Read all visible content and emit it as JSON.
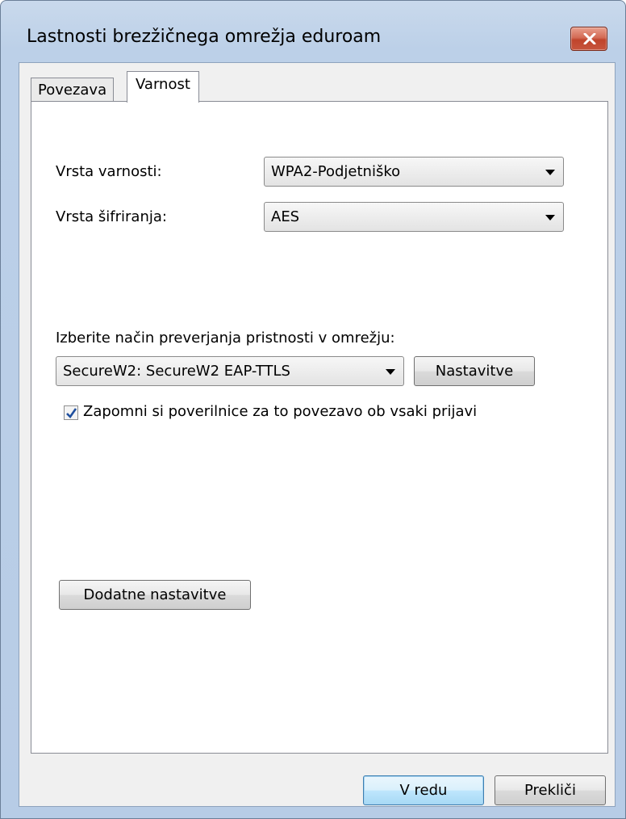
{
  "window": {
    "title": "Lastnosti brezžičnega omrežja eduroam"
  },
  "tabs": [
    {
      "label": "Povezava",
      "selected": false
    },
    {
      "label": "Varnost",
      "selected": true
    }
  ],
  "security": {
    "security_type_label": "Vrsta varnosti:",
    "security_type_value": "WPA2-Podjetniško",
    "encryption_type_label": "Vrsta šifriranja:",
    "encryption_type_value": "AES",
    "auth_method_label": "Izberite način preverjanja pristnosti v omrežju:",
    "auth_method_value": "SecureW2: SecureW2 EAP-TTLS",
    "settings_button": "Nastavitve",
    "remember_credentials_label": "Zapomni si poverilnice za to povezavo ob vsaki prijavi",
    "remember_credentials_checked": true,
    "advanced_settings_button": "Dodatne nastavitve"
  },
  "footer": {
    "ok_button": "V redu",
    "cancel_button": "Prekliči"
  },
  "colors": {
    "close_button": "#c7553d",
    "panel_background": "#ffffff",
    "dialog_background": "#f0f0f0",
    "checkmark": "#1f4f9e"
  },
  "icons": {
    "close": "close-icon",
    "dropdown": "chevron-down-icon",
    "check": "check-icon"
  }
}
